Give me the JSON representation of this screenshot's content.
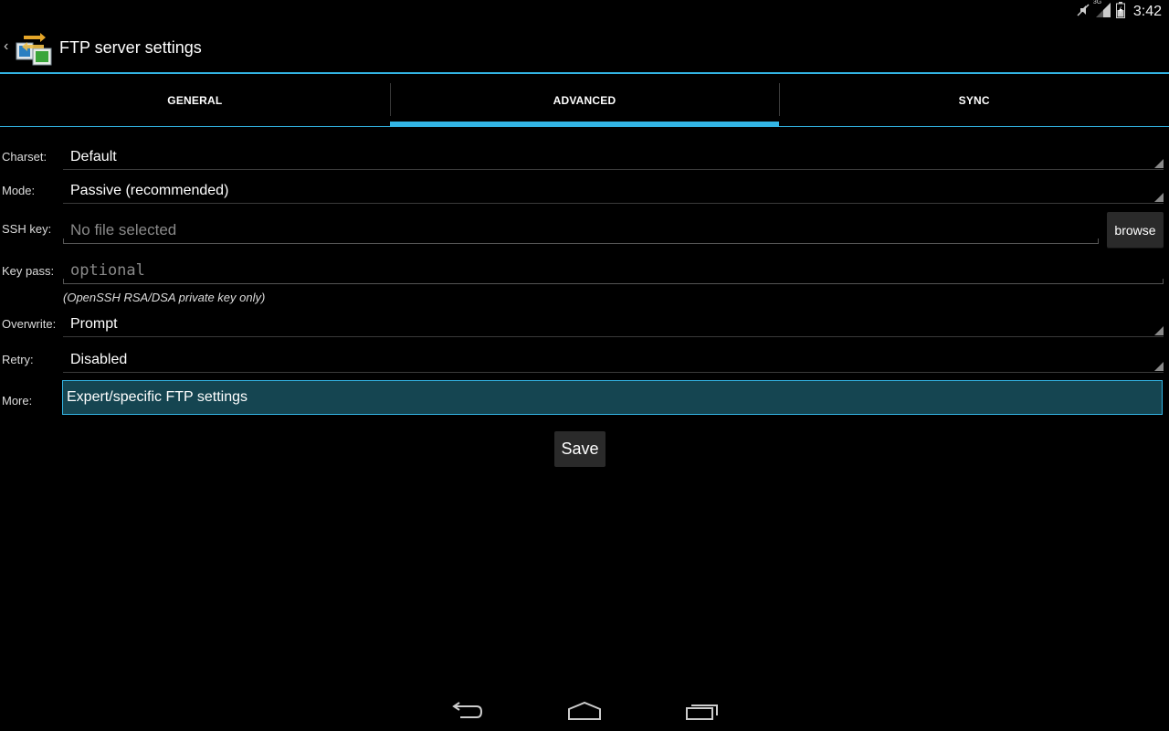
{
  "status_bar": {
    "time": "3:42",
    "network_label": "3G",
    "icons": [
      "mute-icon",
      "signal-icon",
      "battery-icon"
    ]
  },
  "action_bar": {
    "title": "FTP server settings",
    "icon": "ftp-app-icon"
  },
  "tabs": [
    {
      "label": "GENERAL",
      "active": false
    },
    {
      "label": "ADVANCED",
      "active": true
    },
    {
      "label": "SYNC",
      "active": false
    }
  ],
  "form": {
    "charset": {
      "label": "Charset:",
      "value": "Default"
    },
    "mode": {
      "label": "Mode:",
      "value": "Passive (recommended)"
    },
    "ssh_key": {
      "label": "SSH key:",
      "placeholder": "No file selected",
      "button": "browse"
    },
    "key_pass": {
      "label": "Key pass:",
      "placeholder": "optional",
      "hint": "(OpenSSH RSA/DSA private key only)"
    },
    "overwrite": {
      "label": "Overwrite:",
      "value": "Prompt"
    },
    "retry": {
      "label": "Retry:",
      "value": "Disabled"
    },
    "more": {
      "label": "More:",
      "button": "Expert/specific FTP settings"
    }
  },
  "save_label": "Save",
  "nav_bar": {
    "icons": [
      "back-icon",
      "home-icon",
      "recent-apps-icon"
    ]
  },
  "colors": {
    "accent": "#33b5e5",
    "background": "#000000",
    "selected_button": "#154551"
  }
}
